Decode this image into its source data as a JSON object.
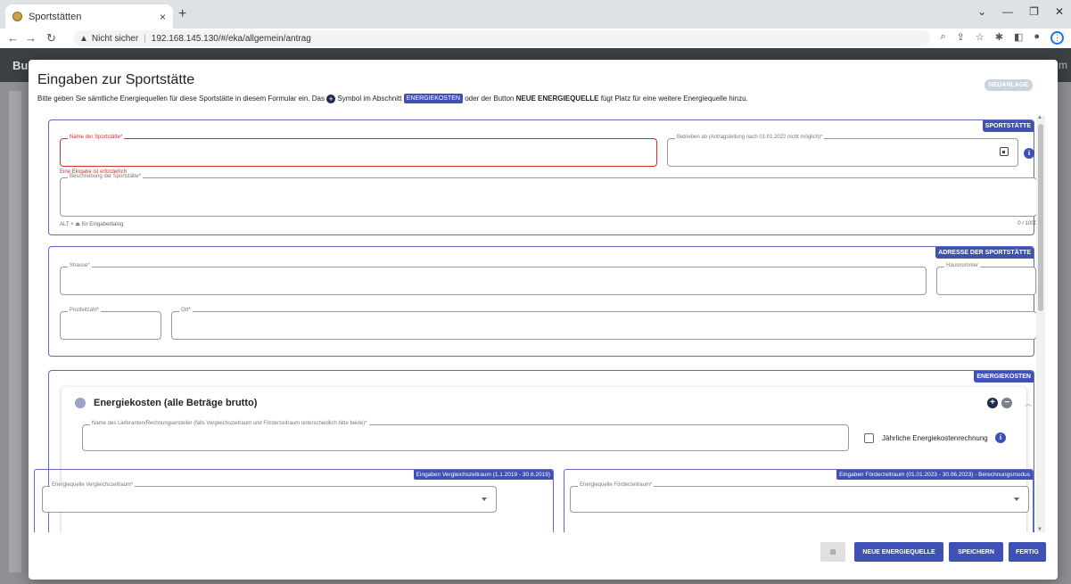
{
  "browser": {
    "tab_title": "Sportstätten",
    "tab_close": "×",
    "new_tab": "+",
    "url_warning": "Nicht sicher",
    "url": "192.168.145.130/#/eka/allgemein/antrag",
    "icons": [
      "back-icon",
      "forward-icon",
      "reload-icon",
      "warning-icon",
      "zoom-icon",
      "share-icon",
      "star-icon",
      "extensions-icon",
      "sidepanel-icon",
      "profile-icon",
      "menu-icon"
    ]
  },
  "app": {
    "brand": "Bu",
    "header_right": "m"
  },
  "dialog": {
    "title": "Eingaben zur Sportstätte",
    "desc_part1": "Bitte geben Sie sämtliche Energiequellen für diese Sportstätte in diesem Formular ein. Das",
    "desc_part2": "Symbol im Abschnitt",
    "desc_chip": "ENERGIEKOSTEN",
    "desc_part3": "oder der Button",
    "desc_bold": "NEUE ENERGIEQUELLE",
    "desc_part4": "fügt Platz für eine weitere Energiequelle hinzu.",
    "status_badge": "NEUANLAGE"
  },
  "sportstaette": {
    "chip": "SPORTSTÄTTE",
    "name_label": "Name der Sportstätte*",
    "name_error": "Eine Eingabe ist erforderlich",
    "betrieben_label": "Betrieben ab (Antragstellung nach 01.01.2022 nicht möglich)*",
    "beschreibung_label": "Beschreibung der Sportstätte*",
    "beschreibung_hint": "ALT + ⏏ für Eingabedialog",
    "beschreibung_counter": "0 / 1000"
  },
  "adresse": {
    "chip": "ADRESSE DER SPORTSTÄTTE",
    "strasse_label": "Strasse*",
    "hausnummer_label": "Hausnummer",
    "plz_label": "Postleitzahl*",
    "ort_label": "Ort*"
  },
  "energiekosten": {
    "chip": "ENERGIEKOSTEN",
    "panel_title": "Energiekosten (alle Beträge brutto)",
    "lieferant_label": "Name des Lieferanten/Rechnungsersteller (falls Vergleichszeitraum und Förderzeitraum unterschiedlich bitte beide)*",
    "jaehrlich_label": "Jährliche Energiekostenrechnung",
    "vergleich_chip": "Eingaben Vergleichszeitraum (1.1.2019 - 30.6.2019)",
    "vergleich_select_label": "Energiequelle Vergleichszeitraum*",
    "foerder_chip": "Eingaben Förderzeitraum (01.01.2023 - 30.06.2023) - Berechnungsmodus",
    "foerder_select_label": "Energiequelle Förderzeitraum*"
  },
  "footer": {
    "neue_energiequelle": "NEUE ENERGIEQUELLE",
    "speichern": "SPEICHERN",
    "fertig": "FERTIG"
  },
  "colors": {
    "primary": "#3f51b5",
    "error": "#d32f2f"
  }
}
